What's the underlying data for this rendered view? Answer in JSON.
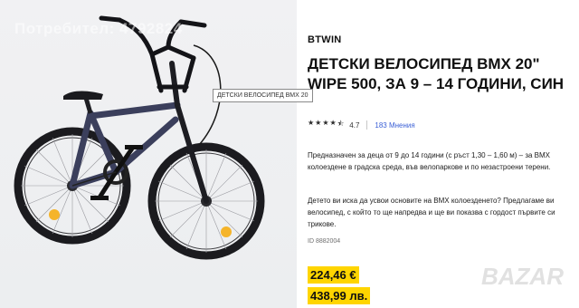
{
  "watermark": "Потребител: 4792824",
  "tooltip": "ДЕТСКИ ВЕЛОСИПЕД BMX 20",
  "brand": "BTWIN",
  "title": "ДЕТСКИ ВЕЛОСИПЕД BMX 20\" WIPE 500, ЗА 9 – 14 ГОДИНИ, СИН",
  "rating": {
    "stars": 4.5,
    "value": "4.7",
    "reviews": "183 Мнения"
  },
  "description": {
    "p1": "Предназначен за деца от 9 до 14 години (с ръст 1,30 – 1,60 м) – за BMX колоездене в градска среда, във велопаркове и по незастроени терени.",
    "p2": "Детето ви иска да усвои основите на BMX колоезденето? Предлагаме ви велосипед, с който то ще напредва и ще ви показва с гордост първите си трикове."
  },
  "product_id": "ID 8882004",
  "price": {
    "sale": "224,46 €",
    "old": "438,99 лв."
  },
  "site_logo": "BAZAR",
  "colors": {
    "accent_yellow": "#ffd500",
    "link_blue": "#3a5fd6",
    "bike_frame": "#3b3f5c"
  }
}
